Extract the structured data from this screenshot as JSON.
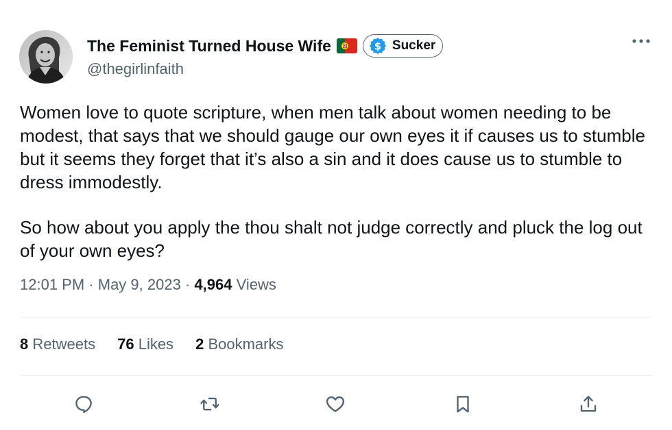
{
  "author": {
    "display_name": "The Feminist Turned House Wife",
    "handle": "@thegirlinfaith",
    "flag_icon": "portugal-flag-icon",
    "badge": {
      "icon": "dollar-coin-icon",
      "label": "Sucker",
      "accent": "#1d9bf0"
    },
    "avatar_alt": "avatar"
  },
  "tweet": {
    "paragraphs": [
      "Women love to quote scripture, when men talk about women needing to be modest, that says that we should gauge our own eyes it if causes us to stumble but it seems they forget that it’s also a sin and it does cause us to stumble to dress immodestly.",
      "So how about you apply the thou shalt not judge correctly and pluck the log out of your own eyes?"
    ]
  },
  "meta": {
    "time": "12:01 PM",
    "separator": "·",
    "date": "May 9, 2023",
    "views_count": "4,964",
    "views_label": "Views"
  },
  "stats": {
    "retweets_count": "8",
    "retweets_label": "Retweets",
    "likes_count": "76",
    "likes_label": "Likes",
    "bookmarks_count": "2",
    "bookmarks_label": "Bookmarks"
  },
  "actions": {
    "reply_icon": "reply-icon",
    "retweet_icon": "retweet-icon",
    "like_icon": "heart-icon",
    "bookmark_icon": "bookmark-icon",
    "share_icon": "share-icon"
  },
  "colors": {
    "text_primary": "#0f1419",
    "text_secondary": "#536471",
    "divider": "#eff3f4",
    "verified_blue": "#1d9bf0"
  }
}
